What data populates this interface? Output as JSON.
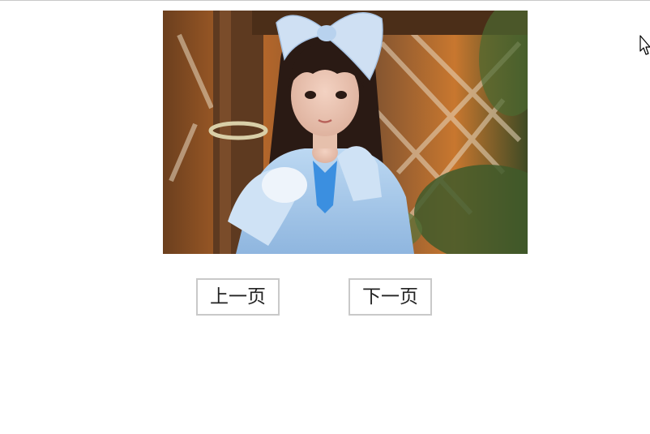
{
  "image": {
    "alt": "",
    "icon": "photo"
  },
  "buttons": {
    "prev_label": "上一页",
    "next_label": "下一页"
  },
  "cursor": {
    "icon": "mouse-pointer-icon"
  }
}
